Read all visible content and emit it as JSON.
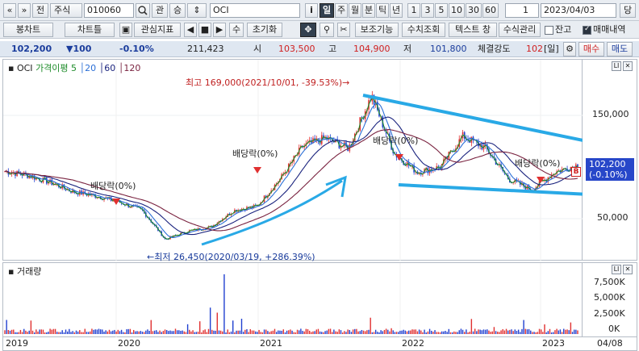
{
  "toolbar_top": {
    "prev_label": "«",
    "next_label": "»",
    "jeon_label": "전",
    "type_label": "주식",
    "code_value": "010060",
    "search_icon": "search-icon",
    "gwan_label": "관",
    "seung_label": "승",
    "name_value": "OCI",
    "info_label": "i",
    "periods": [
      "일",
      "주",
      "월",
      "분",
      "틱",
      "년"
    ],
    "selected_period": "일",
    "intervals": [
      "1",
      "3",
      "5",
      "10",
      "30",
      "60"
    ],
    "count_value": "1",
    "date_value": "2023/04/03",
    "dang_label": "당"
  },
  "toolbar_second": {
    "buttons": [
      "봉차트",
      "차트틀",
      "관심지표"
    ],
    "nav": [
      "◀",
      "■",
      "▶"
    ],
    "su_label": "수",
    "reset_label": "초기화",
    "tools": [
      "보조기능",
      "수치조회",
      "텍스트 창",
      "수식관리"
    ],
    "janko_label": "잔고",
    "trade_label": "매매내역"
  },
  "info_bar": {
    "price": "102,200",
    "change": "▼100",
    "rate": "-0.10%",
    "volume": "211,423",
    "open_label": "시",
    "open": "103,500",
    "high_label": "고",
    "high": "104,900",
    "low_label": "저",
    "low": "101,800",
    "strength_label": "체결강도",
    "strength": "102",
    "period_tag": "[일]",
    "buy_label": "매수",
    "sell_label": "매도"
  },
  "price_pane": {
    "symbol": "OCI",
    "ma_label": "가격이평 5",
    "ma_periods": [
      "20",
      "60",
      "120"
    ],
    "high_annotation": "최고 169,000(2021/10/01, -39.53%)→",
    "low_annotation": "←최저 26,450(2020/03/19, +286.39%)",
    "dividend_labels": [
      "배당락(0%)",
      "배당락(0%)",
      "배당락(0%)",
      "배당락(0%)"
    ],
    "price_badge": "102,200",
    "rate_badge": "(-0.10%)",
    "mark_b": "B",
    "axis_ticks": [
      "150,000",
      "50,000"
    ]
  },
  "volume_pane": {
    "title": "거래량",
    "axis_ticks": [
      "7,500K",
      "5,000K",
      "2,500K",
      "0K"
    ]
  },
  "x_axis": {
    "years": [
      "2019",
      "2020",
      "2021",
      "2022",
      "2023"
    ],
    "date_label": "04/08"
  },
  "colors": {
    "ma5": "#1e8c2a",
    "ma20": "#2b6fd6",
    "ma60": "#1a237e",
    "ma120": "#7a2340",
    "trend": "#29a9e6",
    "up": "#e03030",
    "down": "#2040d0"
  },
  "chart_data": {
    "type": "candlestick",
    "series": [
      {
        "name": "OCI",
        "points": [
          [
            "2019-01",
            96000
          ],
          [
            "2019-03",
            92000
          ],
          [
            "2019-05",
            85000
          ],
          [
            "2019-07",
            76000
          ],
          [
            "2019-09",
            72000
          ],
          [
            "2019-11",
            66000
          ],
          [
            "2020-01",
            58000
          ],
          [
            "2020-03",
            30000
          ],
          [
            "2020-05",
            38000
          ],
          [
            "2020-07",
            42000
          ],
          [
            "2020-09",
            58000
          ],
          [
            "2020-11",
            62000
          ],
          [
            "2021-01",
            88000
          ],
          [
            "2021-03",
            120000
          ],
          [
            "2021-05",
            128000
          ],
          [
            "2021-07",
            118000
          ],
          [
            "2021-10",
            169000
          ],
          [
            "2021-12",
            113000
          ],
          [
            "2022-02",
            95000
          ],
          [
            "2022-04",
            100000
          ],
          [
            "2022-06",
            130000
          ],
          [
            "2022-08",
            118000
          ],
          [
            "2022-10",
            88000
          ],
          [
            "2022-12",
            78000
          ],
          [
            "2023-02",
            95000
          ],
          [
            "2023-04",
            102200
          ]
        ]
      }
    ]
  }
}
